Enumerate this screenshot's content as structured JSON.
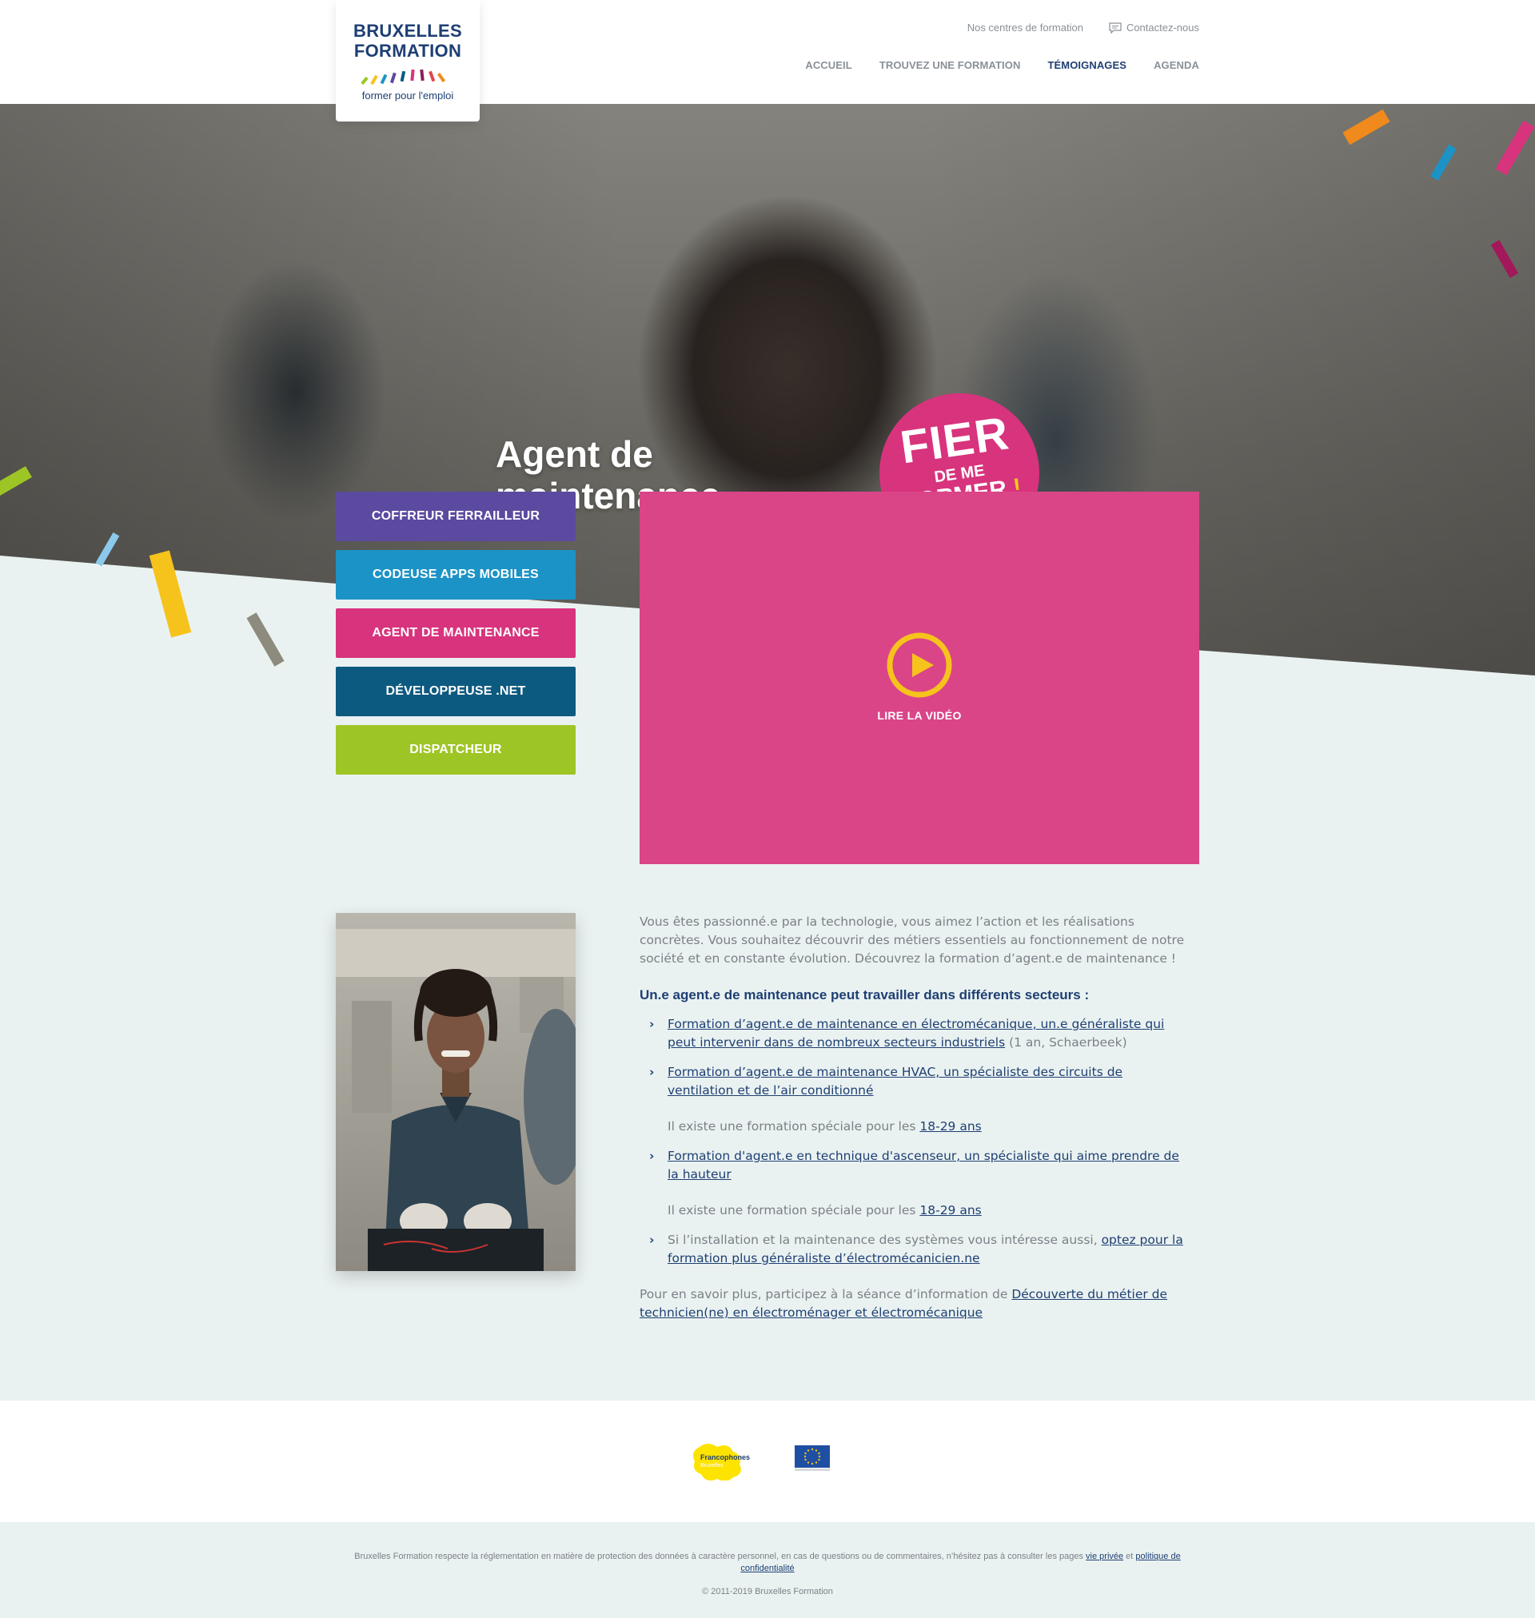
{
  "logo": {
    "line1": "BRUXELLES",
    "line2": "FORMATION",
    "tagline": "former pour l'emploi"
  },
  "utility_nav": {
    "centres": "Nos centres de formation",
    "contact": "Contactez-nous"
  },
  "main_nav": [
    {
      "label": "ACCUEIL"
    },
    {
      "label": "TROUVEZ UNE FORMATION"
    },
    {
      "label": "TÉMOIGNAGES",
      "active": true
    },
    {
      "label": "AGENDA"
    }
  ],
  "hero": {
    "title_line1": "Agent de",
    "title_line2": "maintenance",
    "badge": {
      "big": "FIER",
      "mid": "DE ME",
      "low": "FORMER",
      "excl": "!"
    }
  },
  "testimonials": [
    {
      "label": "COFFREUR FERRAILLEUR",
      "color": "#5b4aa0"
    },
    {
      "label": "CODEUSE APPS MOBILES",
      "color": "#1c93c6"
    },
    {
      "label": "AGENT DE MAINTENANCE",
      "color": "#d8337d"
    },
    {
      "label": "DÉVELOPPEUSE .NET",
      "color": "#0d5a80"
    },
    {
      "label": "DISPATCHEUR",
      "color": "#9ec526"
    }
  ],
  "video": {
    "label": "LIRE LA VIDÉO",
    "bg_color": "#da4588",
    "play_color": "#f6c31c"
  },
  "content": {
    "intro": "Vous êtes passionné.e par la technologie, vous aimez l’action et les réalisations concrètes. Vous souhaitez découvrir des métiers essentiels au fonctionnement de notre société et en constante évolution. Découvrez la formation d’agent.e de maintenance !",
    "heading": "Un.e agent.e de maintenance peut travailler dans différents secteurs :",
    "item1_link": "Formation d’agent.e de maintenance en électromécanique, un.e généraliste qui peut intervenir dans de nombreux secteurs industriels",
    "item1_suffix": " (1 an, Schaerbeek)",
    "item2_link": "Formation d’agent.e de maintenance HVAC, un spécialiste des circuits de ventilation et de l’air conditionné",
    "note1_text": "Il existe une formation spéciale pour les ",
    "note1_link": "18-29 ans",
    "item3_link": "Formation d'agent.e en technique d'ascenseur, un spécialiste qui aime prendre de la hauteur",
    "note2_text": "Il existe une formation spéciale pour les ",
    "note2_link": "18-29 ans",
    "item4_text": "Si l’installation et la maintenance des systèmes vous intéresse aussi, ",
    "item4_link": "optez pour la formation plus généraliste d’électromécanicien.ne",
    "outro_text": "Pour en savoir plus, participez à la séance d’information de ",
    "outro_link": "Découverte du métier de technicien(ne) en électroménager et électromécanique"
  },
  "partners": {
    "fwb_label": "Francophones",
    "fwb_sub": "Bruxelles"
  },
  "footer": {
    "legal_text": "Bruxelles Formation respecte la réglementation en matière de protection des données à caractère personnel, en cas de questions ou de commentaires, n’hésitez pas à consulter les pages ",
    "link_privacy": "vie privée",
    "and": " et ",
    "link_policy": "politique de confidentialité",
    "copyright": "© 2011-2019 Bruxelles Formation"
  },
  "colors": {
    "navy": "#1e3f73",
    "pink": "#d8337d",
    "yellow": "#f6c31c",
    "bg_light": "#eaf2f1"
  }
}
